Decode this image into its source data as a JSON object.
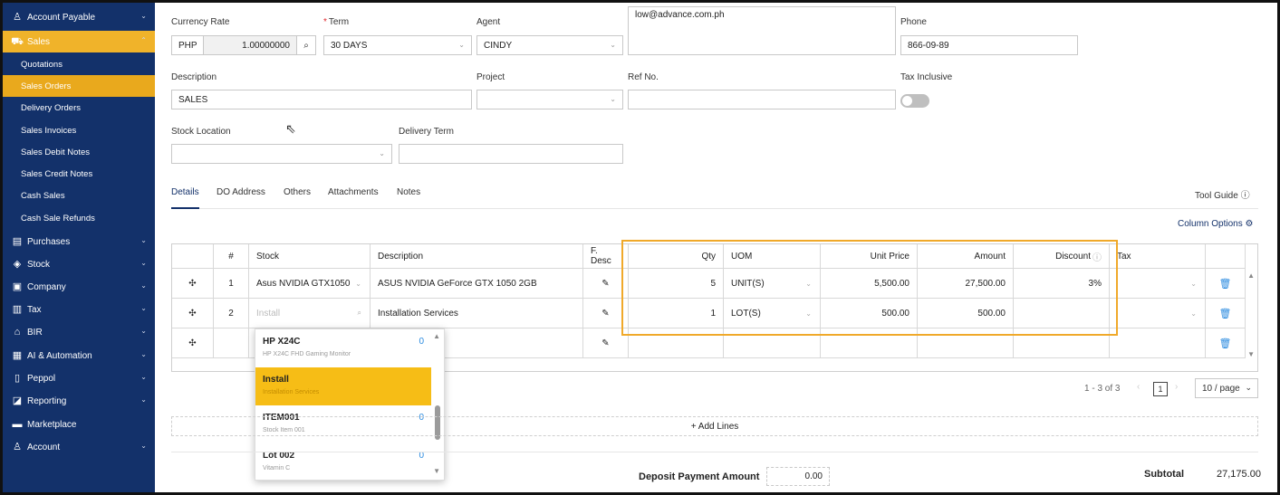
{
  "sidebar": {
    "items": [
      {
        "label": "Account Payable",
        "icon": "person-icon",
        "chevron": "⌄"
      },
      {
        "label": "Sales",
        "icon": "basket-icon",
        "chevron": "⌃"
      },
      {
        "label": "Quotations"
      },
      {
        "label": "Sales Orders"
      },
      {
        "label": "Delivery Orders"
      },
      {
        "label": "Sales Invoices"
      },
      {
        "label": "Sales Debit Notes"
      },
      {
        "label": "Sales Credit Notes"
      },
      {
        "label": "Cash Sales"
      },
      {
        "label": "Cash Sale Refunds"
      },
      {
        "label": "Purchases",
        "icon": "document-icon",
        "chevron": "⌄"
      },
      {
        "label": "Stock",
        "icon": "box-icon",
        "chevron": "⌄"
      },
      {
        "label": "Company",
        "icon": "building-icon",
        "chevron": "⌄"
      },
      {
        "label": "Tax",
        "icon": "tax-icon",
        "chevron": "⌄"
      },
      {
        "label": "BIR",
        "icon": "bank-icon",
        "chevron": "⌄"
      },
      {
        "label": "AI & Automation",
        "icon": "robot-icon",
        "chevron": "⌄"
      },
      {
        "label": "Peppol",
        "icon": "file-icon",
        "chevron": "⌄"
      },
      {
        "label": "Reporting",
        "icon": "chart-icon",
        "chevron": "⌄"
      },
      {
        "label": "Marketplace",
        "icon": "store-icon"
      },
      {
        "label": "Account",
        "icon": "user-icon",
        "chevron": "⌄"
      }
    ]
  },
  "form": {
    "currency_label": "Currency Rate",
    "currency_code": "PHP",
    "currency_rate": "1.00000000",
    "term_req": "*",
    "term_label": "Term",
    "term_value": "30 DAYS",
    "agent_label": "Agent",
    "agent_value": "CINDY",
    "email_value": "low@advance.com.ph",
    "phone_label": "Phone",
    "phone_value": "866-09-89",
    "description_label": "Description",
    "description_value": "SALES",
    "project_label": "Project",
    "ref_label": "Ref No.",
    "tax_inclusive_label": "Tax Inclusive",
    "stock_location_label": "Stock Location",
    "delivery_term_label": "Delivery Term"
  },
  "tabs": [
    "Details",
    "DO Address",
    "Others",
    "Attachments",
    "Notes"
  ],
  "tool_guide": "Tool Guide ⓘ",
  "column_options": "Column Options ⚙",
  "table": {
    "headers": {
      "num": "#",
      "stock": "Stock",
      "description": "Description",
      "fdesc": "F. Desc",
      "qty": "Qty",
      "uom": "UOM",
      "unit_price": "Unit Price",
      "amount": "Amount",
      "discount": "Discount",
      "tax": "Tax"
    },
    "rows": [
      {
        "num": "1",
        "stock": "Asus NVIDIA GTX1050",
        "description": "ASUS NVIDIA GeForce GTX 1050 2GB",
        "qty": "5",
        "uom": "UNIT(S)",
        "unit_price": "5,500.00",
        "amount": "27,500.00",
        "discount": "3%"
      },
      {
        "num": "2",
        "stock": "Install",
        "description": "Installation Services",
        "qty": "1",
        "uom": "LOT(S)",
        "unit_price": "500.00",
        "amount": "500.00",
        "discount": ""
      },
      {
        "num": "",
        "stock": "",
        "description": "",
        "qty": "",
        "uom": "",
        "unit_price": "",
        "amount": "",
        "discount": ""
      }
    ]
  },
  "dropdown": {
    "options": [
      {
        "code": "HP X24C",
        "desc": "HP X24C FHD Gaming Monitor",
        "qty": "0"
      },
      {
        "code": "Install",
        "desc": "Installation Services",
        "qty": ""
      },
      {
        "code": "ITEM001",
        "desc": "Stock Item 001",
        "qty": "0"
      },
      {
        "code": "Lot 002",
        "desc": "Vitamin C",
        "qty": "0"
      }
    ]
  },
  "pagination": {
    "range": "1 - 3 of 3",
    "page": "1",
    "per_page": "10 / page"
  },
  "add_lines": "+ Add Lines",
  "totals": {
    "deposit_label": "Deposit Payment Amount",
    "deposit_value": "0.00",
    "subtotal_label": "Subtotal",
    "subtotal_value": "27,175.00"
  },
  "colors": {
    "sidebar": "#13316a",
    "active": "#e9a91d",
    "highlight": "#f0a92a",
    "link": "#2b8be0"
  }
}
